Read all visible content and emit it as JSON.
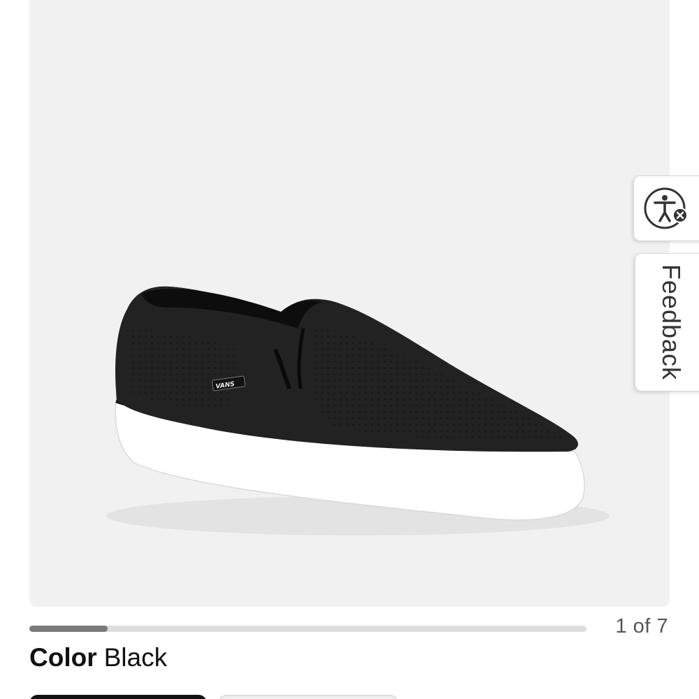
{
  "gallery": {
    "counter": "1 of 7",
    "progress_fraction": 0.14,
    "shoe_logo": "VANS"
  },
  "color": {
    "label": "Color",
    "value": "Black"
  },
  "side_tabs": {
    "accessibility_icon": "accessibility-icon",
    "feedback_label": "Feedback"
  },
  "colors": {
    "image_background": "#f1f1f1",
    "progress_track": "#dedede",
    "progress_fill": "#7a7a7a",
    "selected_swatch": "#111111"
  }
}
